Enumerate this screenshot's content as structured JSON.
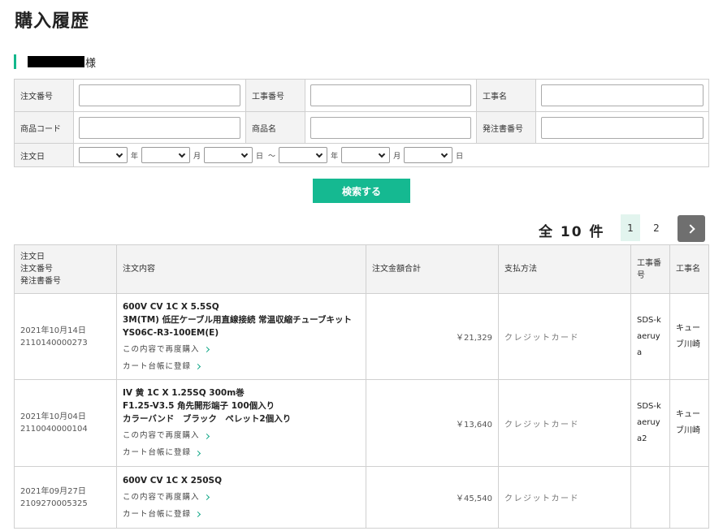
{
  "page": {
    "title": "購入履歴"
  },
  "customer": {
    "honorific": "様"
  },
  "search_form": {
    "order_number_label": "注文番号",
    "project_number_label": "工事番号",
    "project_name_label": "工事名",
    "product_code_label": "商品コード",
    "product_name_label": "商品名",
    "po_number_label": "発注書番号",
    "order_date_label": "注文日",
    "date_unit_year": "年",
    "date_unit_month": "月",
    "date_unit_day": "日",
    "date_range_sep": "～",
    "order_number_value": "",
    "project_number_value": "",
    "project_name_value": "",
    "product_code_value": "",
    "product_name_value": "",
    "po_number_value": "",
    "submit_label": "検索する"
  },
  "results": {
    "total_label": "全 10 件",
    "pages": [
      "1",
      "2"
    ],
    "current_page": 1
  },
  "table": {
    "header_date_lines": [
      "注文日",
      "注文番号",
      "発注書番号"
    ],
    "header_items": "注文内容",
    "header_amount": "注文金額合計",
    "header_payment": "支払方法",
    "header_project_no": "工事番号",
    "header_project_name": "工事名",
    "rows": [
      {
        "date": "2021年10月14日",
        "order_number": "2110140000273",
        "items": [
          "600V CV 1C X 5.5SQ",
          "3M(TM) 低圧ケーブル用直線接続 常温収縮チューブキット",
          "YS06C-R3-100EM(E)"
        ],
        "reorder_label": "この内容で再度購入",
        "cart_label": "カート台帳に登録",
        "amount": "￥21,329",
        "payment": "クレジットカード",
        "project_number": "SDS-kaeruya",
        "project_name": "キューブ川崎"
      },
      {
        "date": "2021年10月04日",
        "order_number": "2110040000104",
        "items": [
          "IV 黄 1C X 1.25SQ 300m巻",
          "F1.25-V3.5 角先開形端子 100個入り",
          "カラーバンド　ブラック　ペレット2個入り"
        ],
        "reorder_label": "この内容で再度購入",
        "cart_label": "カート台帳に登録",
        "amount": "￥13,640",
        "payment": "クレジットカード",
        "project_number": "SDS-kaeruya2",
        "project_name": "キューブ川崎"
      },
      {
        "date": "2021年09月27日",
        "order_number": "2109270005325",
        "items": [
          "600V CV 1C X 250SQ"
        ],
        "reorder_label": "この内容で再度購入",
        "cart_label": "カート台帳に登録",
        "amount": "￥45,540",
        "payment": "クレジットカード",
        "project_number": "",
        "project_name": ""
      }
    ]
  }
}
